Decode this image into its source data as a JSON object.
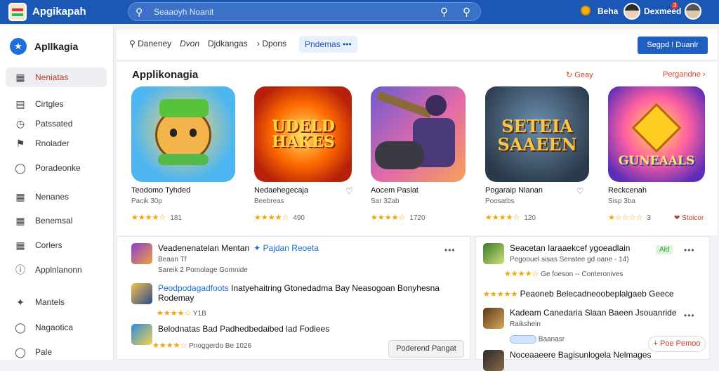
{
  "app": {
    "title": "Apgikapah",
    "search_placeholder": "Seaaoyh Noanit"
  },
  "topbar": {
    "label1": "Beha",
    "label2": "Dexmeed",
    "badge": "3"
  },
  "sidebar": {
    "header": "Apllkagia",
    "items": [
      {
        "label": "Neniatas",
        "icon": "grid-icon"
      },
      {
        "label": "Cirtgles",
        "icon": "book-icon"
      },
      {
        "label": "Patssated",
        "icon": "clock-icon"
      },
      {
        "label": "Rnolader",
        "icon": "flag-icon"
      },
      {
        "label": "Poradeonke",
        "icon": "shield-icon"
      },
      {
        "label": "Nenanes",
        "icon": "grid-icon"
      },
      {
        "label": "Benemsal",
        "icon": "grid-icon"
      },
      {
        "label": "Corlers",
        "icon": "grid-icon"
      },
      {
        "label": "Applnlanonn",
        "icon": "alert-icon"
      },
      {
        "label": "Mantels",
        "icon": "tool-icon"
      },
      {
        "label": "Nagaotica",
        "icon": "chat-icon"
      },
      {
        "label": "Pale",
        "icon": "chat-icon"
      }
    ]
  },
  "tabs": [
    {
      "label": "Daneney"
    },
    {
      "label": "Dvon"
    },
    {
      "label": "Djdkangas"
    },
    {
      "label": "Dpons"
    },
    {
      "label": "Pndemas"
    }
  ],
  "primary_button": "Segpd ! Duanlr",
  "featured": {
    "title": "Applikonagia",
    "link1": "Geay",
    "link2": "Pergandne",
    "cards": [
      {
        "name": "Teodomo Tyhded",
        "sub": "Pacik 30p",
        "rating": "★★★★☆",
        "count": "181",
        "art_text": ""
      },
      {
        "name": "Nedaehegecaja",
        "sub": "Beebreas",
        "rating": "★★★★☆",
        "count": "490",
        "art_text": "UDELD HAKES"
      },
      {
        "name": "Aocem Paslat",
        "sub": "Sar 32ab",
        "rating": "★★★★☆",
        "count": "1720",
        "art_text": ""
      },
      {
        "name": "Pogaraip Nlanan",
        "sub": "Poosatbs",
        "rating": "★★★★☆",
        "count": "120",
        "art_text": "SETEIA SAAEEN"
      },
      {
        "name": "Reckcenah",
        "sub": "Sisp 3ba",
        "rating": "★☆☆☆☆",
        "count": "3",
        "art_text": "GUNEAALS",
        "action": "Stoicor"
      }
    ]
  },
  "list_left": [
    {
      "title": "Veadenenatelan Mentan",
      "link": "Pajdan Reoeta",
      "sub": "Beaan Tf",
      "meta": "Sareik 2 Pomolage  Gomnide"
    },
    {
      "title": "Peodpodagadfoots",
      "title2": "Inatyehaitring Gtonedadma Bay Neasogoan Bonyhesna",
      "title3": "Rodemay",
      "rating": "★★★★☆",
      "count": "Y1B"
    },
    {
      "title": "Belodnatas Bad Padhedbedaibed lad Fodiees",
      "rating": "★★★★☆",
      "meta": "Pnoggerdo  Be 1026",
      "button": "Poderend Pangat"
    }
  ],
  "list_right": [
    {
      "title": "Seacetan Iaraaekcef ygoeadlain",
      "pill": "Ald",
      "sub": "Pegoouel sisas Senstee gd oane  - 14)",
      "rating": "★★★★☆",
      "meta": "Ge foeson -- Conteronives"
    },
    {
      "title": "Peaoneb Belecadneoobeplalgaeb Geece",
      "rating": "★★★★★"
    },
    {
      "title": "Kadeam Canedaria Slaan Baeen Jsouanride",
      "sub": "Raikshein",
      "meta": "Baanasr",
      "button": "+ Poe Pemoo"
    },
    {
      "title": "Noceaaeere Bagisunlogela Nelmages"
    }
  ]
}
